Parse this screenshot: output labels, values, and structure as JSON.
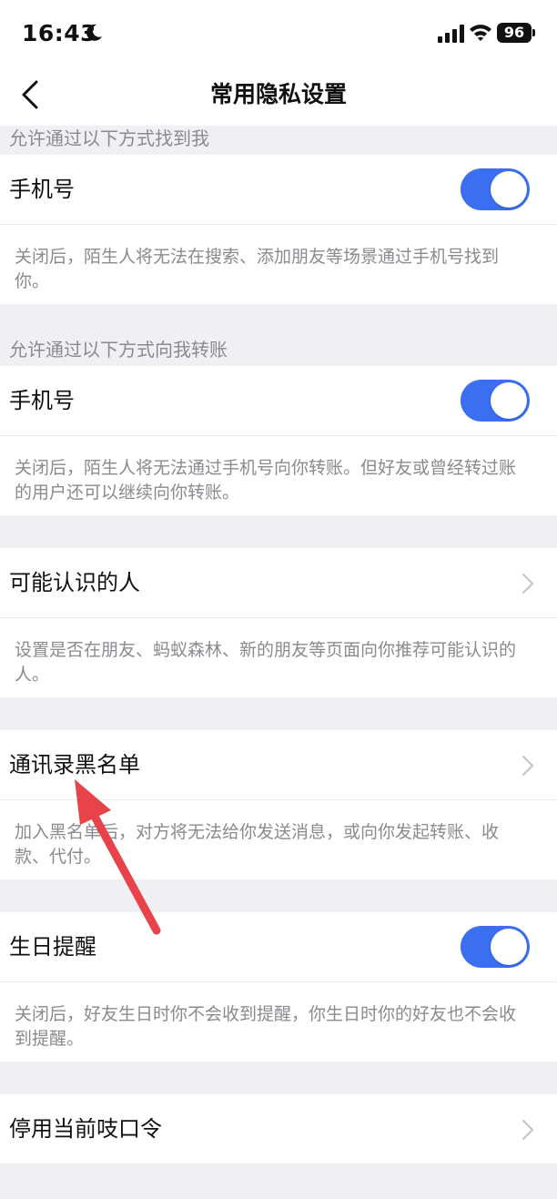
{
  "status_bar": {
    "time": "16:43",
    "battery": "96"
  },
  "nav": {
    "title": "常用隐私设置"
  },
  "sections": {
    "find_me": {
      "header": "允许通过以下方式找到我",
      "row_label": "手机号",
      "toggle_on": true,
      "description": "关闭后，陌生人将无法在搜索、添加朋友等场景通过手机号找到你。"
    },
    "transfer": {
      "header": "允许通过以下方式向我转账",
      "row_label": "手机号",
      "toggle_on": true,
      "description": "关闭后，陌生人将无法通过手机号向你转账。但好友或曾经转过账的用户还可以继续向你转账。"
    },
    "people_you_may_know": {
      "row_label": "可能认识的人",
      "description": "设置是否在朋友、蚂蚁森林、新的朋友等页面向你推荐可能认识的人。"
    },
    "blacklist": {
      "row_label": "通讯录黑名单",
      "description": "加入黑名单后，对方将无法给你发送消息，或向你发起转账、收款、代付。"
    },
    "birthday": {
      "row_label": "生日提醒",
      "toggle_on": true,
      "description": "关闭后，好友生日时你不会收到提醒，你生日时你的好友也不会收到提醒。"
    },
    "password": {
      "row_label": "停用当前吱口令"
    }
  },
  "colors": {
    "toggle_on": "#3b6ef0",
    "background": "#efeff4",
    "annotation_arrow": "#e8424a"
  },
  "icons": {
    "back": "chevron-left-icon",
    "row_arrow": "chevron-right-icon",
    "moon": "moon-icon",
    "signal": "signal-icon",
    "wifi": "wifi-icon"
  }
}
